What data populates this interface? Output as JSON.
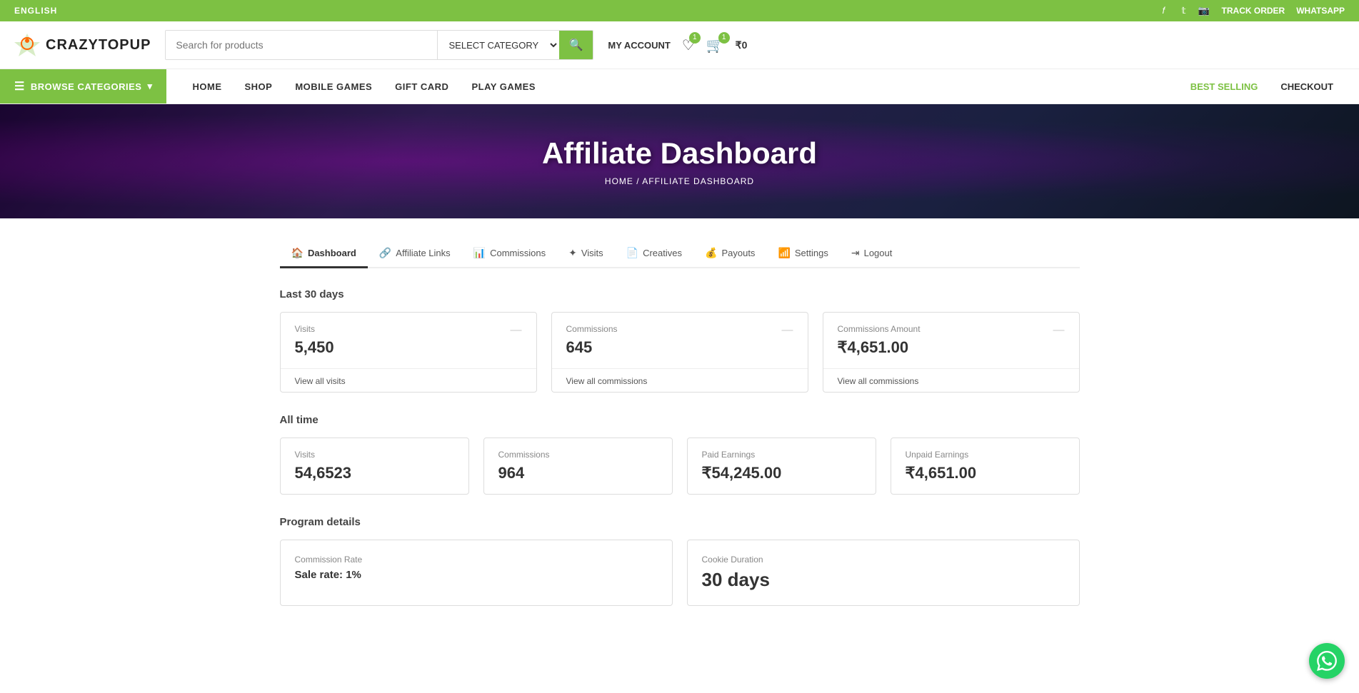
{
  "top_bar": {
    "language": "ENGLISH",
    "social_icons": [
      "facebook",
      "twitter",
      "instagram"
    ],
    "links": [
      "TRACK ORDER",
      "WHATSAPP"
    ]
  },
  "header": {
    "logo_text": "CRAZYTOPUP",
    "search_placeholder": "Search for products",
    "category_label": "SELECT CATEGORY",
    "my_account": "MY ACCOUNT",
    "wishlist_count": "1",
    "cart_count": "1",
    "cart_value": "₹0"
  },
  "nav": {
    "browse_label": "BROWSE CATEGORIES",
    "links": [
      "HOME",
      "SHOP",
      "MOBILE GAMES",
      "GIFT CARD",
      "PLAY GAMES"
    ],
    "right_links": {
      "best_selling": "BEST SELLING",
      "checkout": "CHECKOUT"
    }
  },
  "hero": {
    "title": "Affiliate Dashboard",
    "breadcrumb_home": "HOME",
    "breadcrumb_separator": "/",
    "breadcrumb_current": "AFFILIATE DASHBOARD"
  },
  "tabs": [
    {
      "id": "dashboard",
      "label": "Dashboard",
      "icon": "🏠",
      "active": true
    },
    {
      "id": "affiliate-links",
      "label": "Affiliate Links",
      "icon": "🔗"
    },
    {
      "id": "commissions",
      "label": "Commissions",
      "icon": "📊"
    },
    {
      "id": "visits",
      "label": "Visits",
      "icon": "✦"
    },
    {
      "id": "creatives",
      "label": "Creatives",
      "icon": "📄"
    },
    {
      "id": "payouts",
      "label": "Payouts",
      "icon": "💰"
    },
    {
      "id": "settings",
      "label": "Settings",
      "icon": "📶"
    },
    {
      "id": "logout",
      "label": "Logout",
      "icon": "⇥"
    }
  ],
  "last30days": {
    "label": "Last 30 days",
    "visits": {
      "label": "Visits",
      "value": "5,450",
      "link": "View all visits"
    },
    "commissions": {
      "label": "Commissions",
      "value": "645",
      "link": "View all commissions"
    },
    "commissions_amount": {
      "label": "Commissions Amount",
      "value": "₹4,651.00",
      "link": "View all commissions"
    }
  },
  "alltime": {
    "label": "All time",
    "visits": {
      "label": "Visits",
      "value": "54,6523"
    },
    "commissions": {
      "label": "Commissions",
      "value": "964"
    },
    "paid_earnings": {
      "label": "Paid Earnings",
      "value": "₹54,245.00"
    },
    "unpaid_earnings": {
      "label": "Unpaid Earnings",
      "value": "₹4,651.00"
    }
  },
  "program_details": {
    "label": "Program details",
    "commission_rate": {
      "label": "Commission Rate",
      "value": "Sale rate: 1%"
    },
    "cookie_duration": {
      "label": "Cookie Duration",
      "value": "30 days"
    }
  }
}
